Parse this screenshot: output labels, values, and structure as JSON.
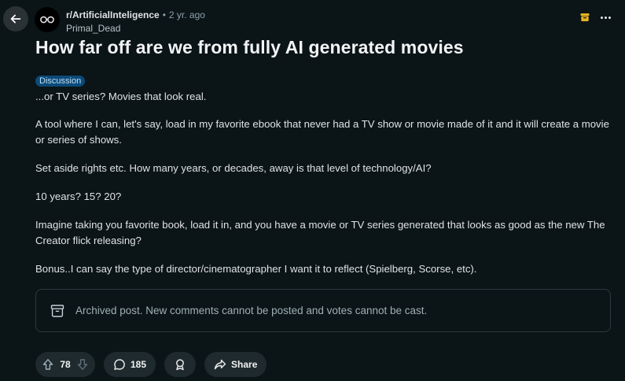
{
  "post": {
    "subreddit": "r/ArtificialInteligence",
    "separator": "•",
    "age": "2 yr. ago",
    "author": "Primal_Dead",
    "title": "How far off are we from fully AI generated movies",
    "flair": "Discussion",
    "body": [
      "...or TV series? Movies that look real.",
      "A tool where I can, let's say, load in my favorite ebook that never had a TV show or movie made of it and it will create a movie or series of shows.",
      "Set aside rights etc. How many years, or decades, away is that level of technology/AI?",
      "10 years? 15? 20?",
      "Imagine taking you favorite book, load it in, and you have a movie or TV series generated that looks as good as the new The Creator flick releasing?",
      "Bonus..I can say the type of director/cinematographer I want it to reflect (Spielberg, Scorse, etc)."
    ],
    "archived_notice": "Archived post. New comments cannot be posted and votes cannot be cast."
  },
  "actions": {
    "votes": "78",
    "comments": "185",
    "share_label": "Share"
  },
  "icons": {
    "back": "arrow-left-icon",
    "avatar": "glasses-icon",
    "archive_badge": "archive-icon",
    "more": "more-horizontal-icon",
    "upvote": "upvote-arrow-icon",
    "downvote": "downvote-arrow-icon",
    "comment": "comment-bubble-icon",
    "award": "award-icon",
    "share": "share-arrow-icon"
  },
  "colors": {
    "background": "#0b1416",
    "flair": "#0a4a7a",
    "archive_badge": "#e6b422",
    "pill": "#1f2a2e"
  }
}
